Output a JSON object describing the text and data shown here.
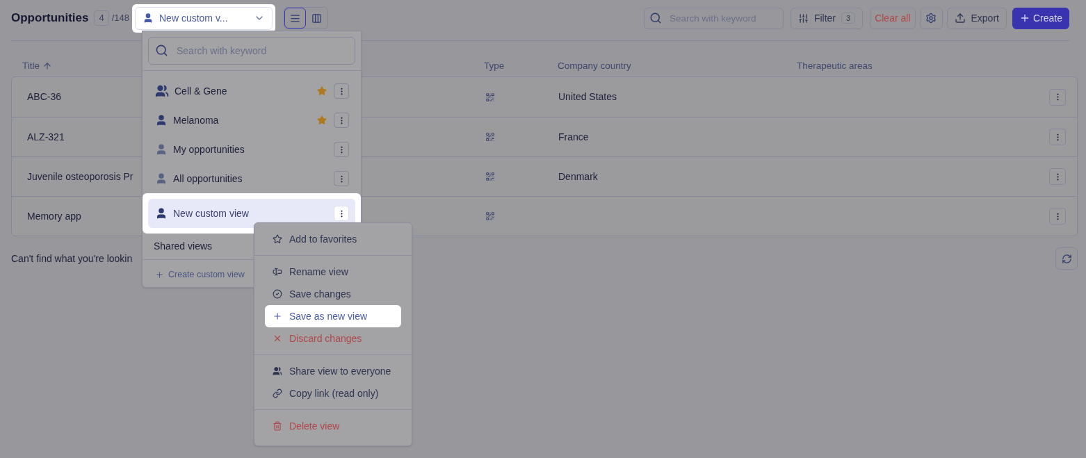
{
  "header": {
    "title": "Opportunities",
    "count": "4",
    "total": "/148"
  },
  "view_selector": {
    "label": "New custom v...",
    "highlighted": true
  },
  "view_toggles": [
    {
      "kind": "list",
      "selected": true
    },
    {
      "kind": "columns",
      "selected": false
    }
  ],
  "toolbar": {
    "search_placeholder": "Search with keyword",
    "filter": {
      "label": "Filter",
      "count": "3"
    },
    "clear": "Clear all",
    "export": "Export",
    "create": "Create"
  },
  "table": {
    "columns": [
      {
        "label": "Title",
        "sorted": true
      },
      {
        "label": "Type",
        "sorted": false
      },
      {
        "label": "Company country",
        "sorted": false
      },
      {
        "label": "Therapeutic areas",
        "sorted": false
      }
    ],
    "rows": [
      {
        "title": "ABC-36",
        "country": "United States"
      },
      {
        "title": "ALZ-321",
        "country": "France"
      },
      {
        "title": "Juvenile osteoporosis Pr",
        "country": "Denmark"
      },
      {
        "title": "Memory app",
        "country": ""
      }
    ]
  },
  "footer": {
    "text": "Can't find what you're lookin"
  },
  "views_dropdown": {
    "search_placeholder": "Search with keyword",
    "items": [
      {
        "label": "Cell & Gene",
        "kind": "team",
        "favorite": true,
        "selected": false
      },
      {
        "label": "Melanoma",
        "kind": "personal",
        "favorite": true,
        "selected": false
      },
      {
        "label": "My opportunities",
        "kind": "system",
        "favorite": false,
        "selected": false
      },
      {
        "label": "All opportunities",
        "kind": "system",
        "favorite": false,
        "selected": false
      },
      {
        "label": "New custom view",
        "kind": "personal",
        "favorite": false,
        "selected": true
      }
    ],
    "shared_heading": "Shared views",
    "create_label": "Create custom view"
  },
  "view_menu": {
    "groups": [
      [
        {
          "label": "Add to favorites",
          "kind": "favorite",
          "highlighted": false
        }
      ],
      [
        {
          "label": "Rename view",
          "kind": "rename",
          "highlighted": false
        },
        {
          "label": "Save changes",
          "kind": "save",
          "highlighted": false
        },
        {
          "label": "Save as new view",
          "kind": "save_new",
          "highlighted": true
        },
        {
          "label": "Discard changes",
          "kind": "discard",
          "highlighted": false
        }
      ],
      [
        {
          "label": "Share view to everyone",
          "kind": "share",
          "highlighted": false
        },
        {
          "label": "Copy link (read only)",
          "kind": "copy_link",
          "highlighted": false
        }
      ],
      [
        {
          "label": "Delete view",
          "kind": "delete",
          "highlighted": false
        }
      ]
    ]
  }
}
